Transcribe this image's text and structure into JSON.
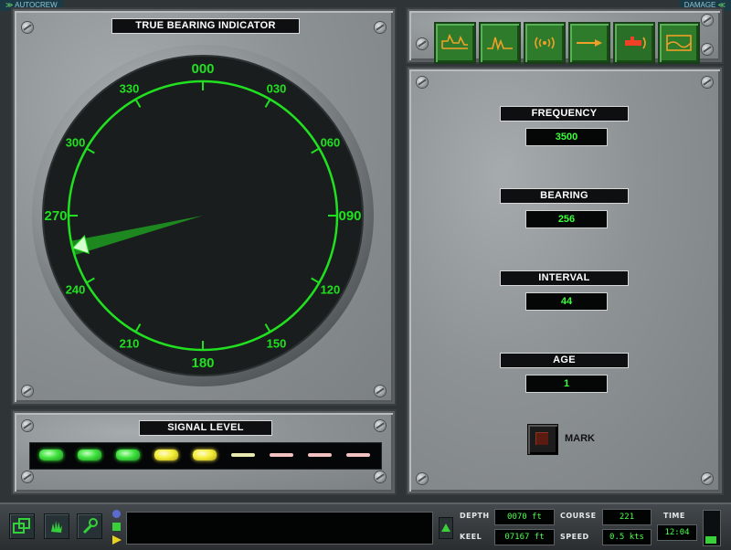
{
  "top_tags": {
    "autocrew": "AUTOCREW",
    "damage": "DAMAGE"
  },
  "bearing_panel": {
    "title": "TRUE BEARING INDICATOR",
    "dial_labels": [
      "000",
      "030",
      "060",
      "090",
      "120",
      "150",
      "180",
      "210",
      "240",
      "270",
      "300",
      "330"
    ],
    "needle_bearing_deg": 256
  },
  "toolbar": {
    "buttons": [
      {
        "name": "waterfall-display-icon"
      },
      {
        "name": "spectrum-analysis-icon"
      },
      {
        "name": "sonar-ping-icon"
      },
      {
        "name": "torpedo-track-icon"
      },
      {
        "name": "contact-track-icon"
      },
      {
        "name": "chart-display-icon"
      }
    ]
  },
  "readouts": {
    "frequency": {
      "label": "FREQUENCY",
      "value": "3500"
    },
    "bearing": {
      "label": "BEARING",
      "value": "256"
    },
    "interval": {
      "label": "INTERVAL",
      "value": "44"
    },
    "age": {
      "label": "AGE",
      "value": "1"
    },
    "mark_label": "MARK"
  },
  "signal_panel": {
    "title": "SIGNAL LEVEL",
    "leds": [
      "green",
      "green",
      "green",
      "yellow",
      "yellow",
      "dim-yellow",
      "dim-pink",
      "dim-pink",
      "dim-pink"
    ]
  },
  "status_bar": {
    "depth_label": "DEPTH",
    "depth_value": "0070 ft",
    "keel_label": "KEEL",
    "keel_value": "07167 ft",
    "course_label": "COURSE",
    "course_value": "221",
    "speed_label": "SPEED",
    "speed_value": "0.5 kts",
    "time_label": "TIME",
    "time_value": "12:04",
    "message": ""
  },
  "colors": {
    "scope_green": "#20e020",
    "lcd_green": "#4cff4c",
    "led_yellow": "#f4ef3a"
  }
}
